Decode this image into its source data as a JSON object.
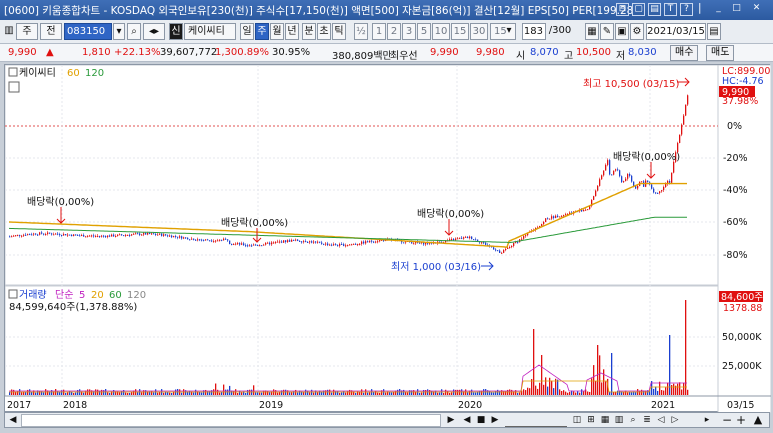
{
  "window": {
    "title": "[0600] 키움종합차트 - KOSDAQ 외국인보유[230(천)] 주식수[17,150(천)] 액면[500] 자본금[86(억)] 결산[12월] EPS[50] PER[199.28",
    "title_icons": [
      "⊟",
      "▢",
      "▤",
      "T",
      "?",
      "|",
      "_",
      "□",
      "✕"
    ]
  },
  "toolbar": {
    "period_label": "주",
    "prev_label": "전",
    "code_value": "083150",
    "stock_badge": "신",
    "stock_name": "케이씨티",
    "timeframes": [
      "일",
      "주",
      "월",
      "년",
      "분",
      "초",
      "틱"
    ],
    "fraction_label": "½",
    "intervals": [
      "1",
      "2",
      "3",
      "5",
      "10",
      "15",
      "30"
    ],
    "interval_value": "15",
    "count_value": "183",
    "count_total": "/300",
    "date_value": "2021/03/15"
  },
  "quote": {
    "price": "9,990",
    "change": "1,810",
    "change_pct": "+22.13%",
    "volume": "39,607,772",
    "volume_pct": "1,300.89%",
    "turnover_pct": "30.95%",
    "trade_value": "380,809백만",
    "best_ask_label": "최우선",
    "best_ask": "9,990",
    "best_bid": "9,980",
    "open_label": "시",
    "open": "8,070",
    "high_label": "고",
    "high": "10,500",
    "low_label": "저",
    "low": "8,030",
    "buy_button": "매수",
    "sell_button": "매도"
  },
  "chart": {
    "stock_label": "케이씨티",
    "ma_labels": [
      "60",
      "120"
    ],
    "lc_label": "LC:899.00",
    "hc_label": "HC:-4.76",
    "price_tag": "9,990",
    "pct_tag": "37.98%",
    "y_ticks": [
      "0%",
      "-20%",
      "-40%",
      "-60%",
      "-80%"
    ],
    "annotations": {
      "high": "최고 10,500 (03/15)",
      "low": "최저 1,000 (03/16)",
      "dividends": [
        "배당락(0,00%)",
        "배당락(0,00%)",
        "배당락(0,00%)",
        "배당락(0,00%)"
      ]
    },
    "volume": {
      "label": "거래량",
      "ma_label": "단순",
      "ma_values": [
        "5",
        "20",
        "60",
        "120"
      ],
      "value_text": "84,599,640주(1,378.88%)",
      "tag": "84,600주",
      "tag2": "1378.88",
      "y_ticks": [
        "50,000K",
        "25,000K"
      ]
    },
    "x_labels": [
      "2017",
      "2018",
      "2019",
      "2020",
      "2021",
      "03/15"
    ]
  },
  "colors": {
    "up": "#e01010",
    "down": "#1a3fd0",
    "ma60": "#e0a000",
    "ma120": "#2a9a3a",
    "title_bg": "#2c5aa0"
  }
}
